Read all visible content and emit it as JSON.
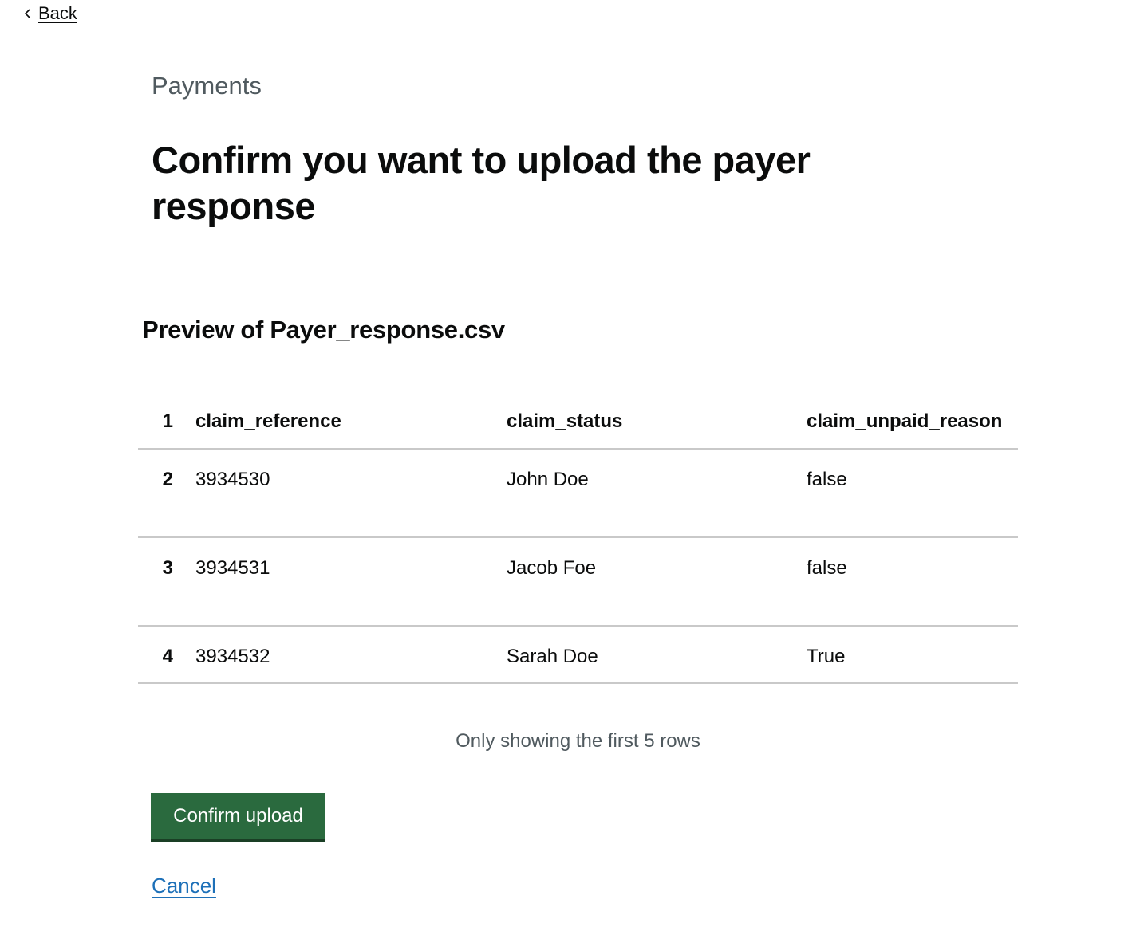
{
  "nav": {
    "back_label": "Back"
  },
  "header": {
    "caption": "Payments",
    "title": "Confirm you want to upload the payer response"
  },
  "preview": {
    "heading": "Preview of Payer_response.csv",
    "columns": {
      "row_number": "1",
      "claim_reference": "claim_reference",
      "claim_status": "claim_status",
      "claim_unpaid_reason": "claim_unpaid_reason"
    },
    "rows": [
      {
        "row_number": "2",
        "claim_reference": "3934530",
        "claim_status": "John Doe",
        "claim_unpaid_reason": "false"
      },
      {
        "row_number": "3",
        "claim_reference": "3934531",
        "claim_status": "Jacob Foe",
        "claim_unpaid_reason": "false"
      },
      {
        "row_number": "4",
        "claim_reference": "3934532",
        "claim_status": "Sarah Doe",
        "claim_unpaid_reason": "True"
      }
    ],
    "note": "Only showing the first 5 rows"
  },
  "actions": {
    "confirm_label": "Confirm upload",
    "cancel_label": "Cancel"
  },
  "colors": {
    "primary_button": "#2a6a3e",
    "link": "#1d70b8",
    "secondary_text": "#505a5f"
  },
  "icons": {
    "back": "chevron-left-icon"
  }
}
